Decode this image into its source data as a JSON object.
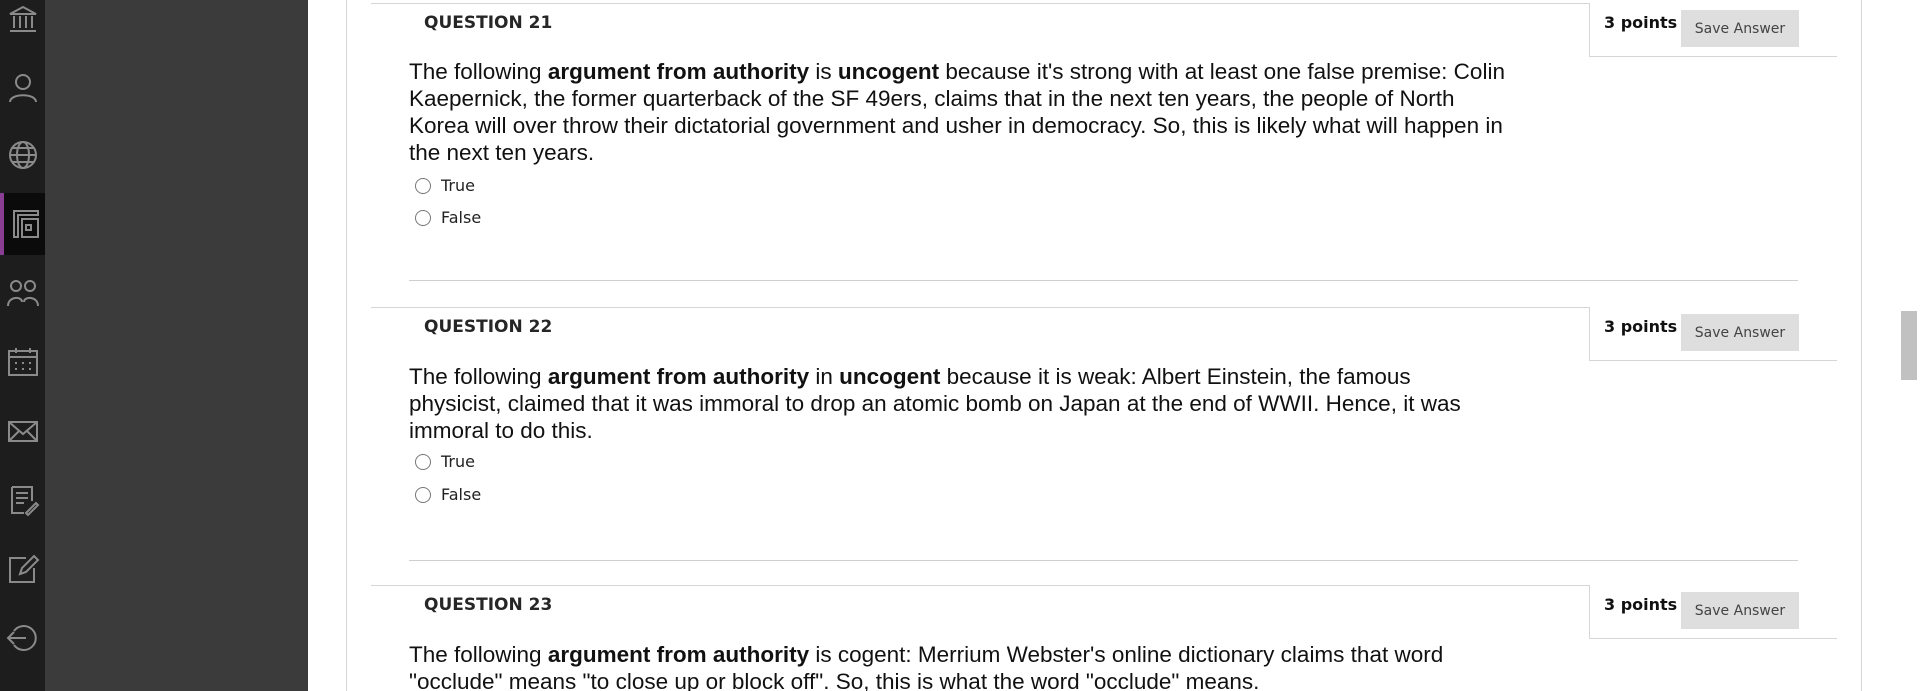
{
  "nav": {
    "items": [
      {
        "name": "institution-icon"
      },
      {
        "name": "profile-icon"
      },
      {
        "name": "globe-icon"
      },
      {
        "name": "courses-icon",
        "active": true
      },
      {
        "name": "groups-icon"
      },
      {
        "name": "calendar-icon"
      },
      {
        "name": "messages-icon"
      },
      {
        "name": "grades-icon"
      },
      {
        "name": "tools-icon"
      },
      {
        "name": "sign-out-icon"
      }
    ],
    "accent_color": "#8a3e93"
  },
  "questions": [
    {
      "title": "QUESTION 21",
      "points": "3 points",
      "save_label": "Save Answer",
      "text_parts": [
        "The following ",
        "argument from authority",
        " is ",
        "uncogent",
        " because it's strong with at least one false premise: Colin Kaepernick, the former quarterback of the SF 49ers, claims that in the next ten years, the people of North Korea will over throw their dictatorial government and usher in democracy.  So, this is likely what will happen in the next ten years."
      ],
      "options": [
        "True",
        "False"
      ]
    },
    {
      "title": "QUESTION 22",
      "points": "3 points",
      "save_label": "Save Answer",
      "text_parts": [
        "The following ",
        "argument from authority",
        " in ",
        "uncogent",
        " because it is weak: Albert Einstein, the famous physicist, claimed that it was immoral to drop an atomic bomb on Japan at the end of WWII.  Hence, it was immoral to do this."
      ],
      "options": [
        "True",
        "False"
      ]
    },
    {
      "title": "QUESTION 23",
      "points": "3 points",
      "save_label": "Save Answer",
      "text_parts": [
        "The following ",
        "argument from authority",
        " is cogent: Merrium Webster's online dictionary claims that word \"occlude\" means \"to close up or block off\".  So, this is what the word \"occlude\" means."
      ]
    }
  ]
}
